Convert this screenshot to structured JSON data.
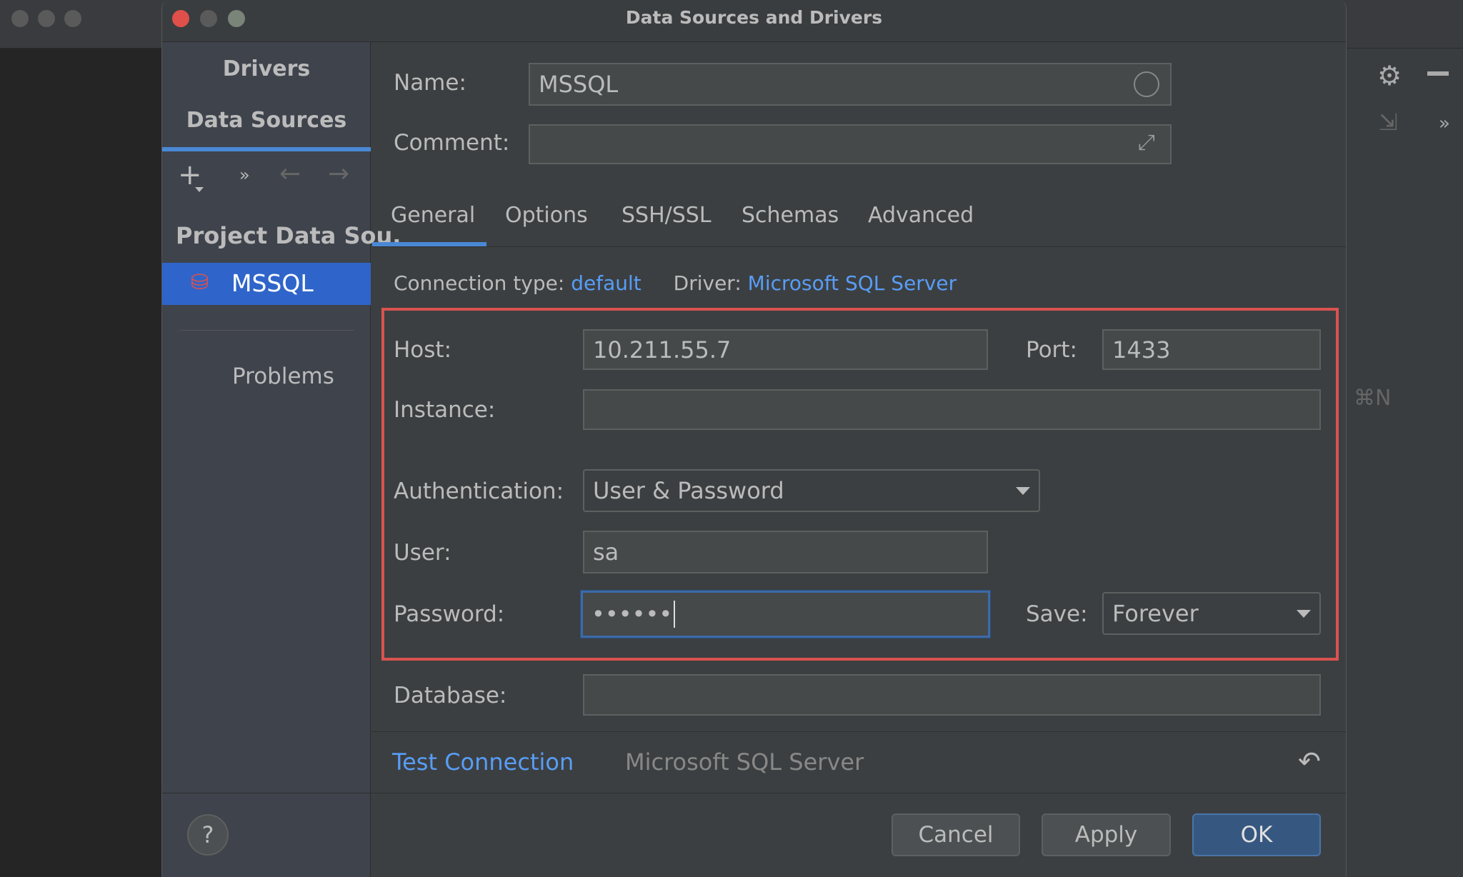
{
  "window": {
    "title": "Data Sources and Drivers"
  },
  "background_app": {
    "shortcut_hint": "⌘N",
    "more_label": "»"
  },
  "sidebar": {
    "tabs": [
      "Drivers",
      "Data Sources"
    ],
    "active_tab": "Data Sources",
    "toolbar": {
      "add": "+",
      "more": "»"
    },
    "section_title": "Project Data Sou.",
    "items": [
      {
        "label": "MSSQL",
        "selected": true
      }
    ],
    "problems_label": "Problems"
  },
  "form": {
    "name_label": "Name:",
    "name_value": "MSSQL",
    "comment_label": "Comment:",
    "comment_value": "",
    "tabs": [
      "General",
      "Options",
      "SSH/SSL",
      "Schemas",
      "Advanced"
    ],
    "active_tab": "General",
    "connection_type_label": "Connection type:",
    "connection_type_value": "default",
    "driver_label": "Driver:",
    "driver_value": "Microsoft SQL Server",
    "host_label": "Host:",
    "host_value": "10.211.55.7",
    "port_label": "Port:",
    "port_value": "1433",
    "instance_label": "Instance:",
    "instance_value": "",
    "auth_label": "Authentication:",
    "auth_value": "User & Password",
    "user_label": "User:",
    "user_value": "sa",
    "password_label": "Password:",
    "password_value": "••••••",
    "save_label": "Save:",
    "save_value": "Forever",
    "database_label": "Database:",
    "database_value": ""
  },
  "footer": {
    "test_connection": "Test Connection",
    "driver_name": "Microsoft SQL Server",
    "help": "?",
    "cancel": "Cancel",
    "apply": "Apply",
    "ok": "OK"
  },
  "colors": {
    "accent": "#589df6",
    "selection": "#2f65ca",
    "highlight_box": "#d9534f",
    "ok_button": "#365880"
  }
}
